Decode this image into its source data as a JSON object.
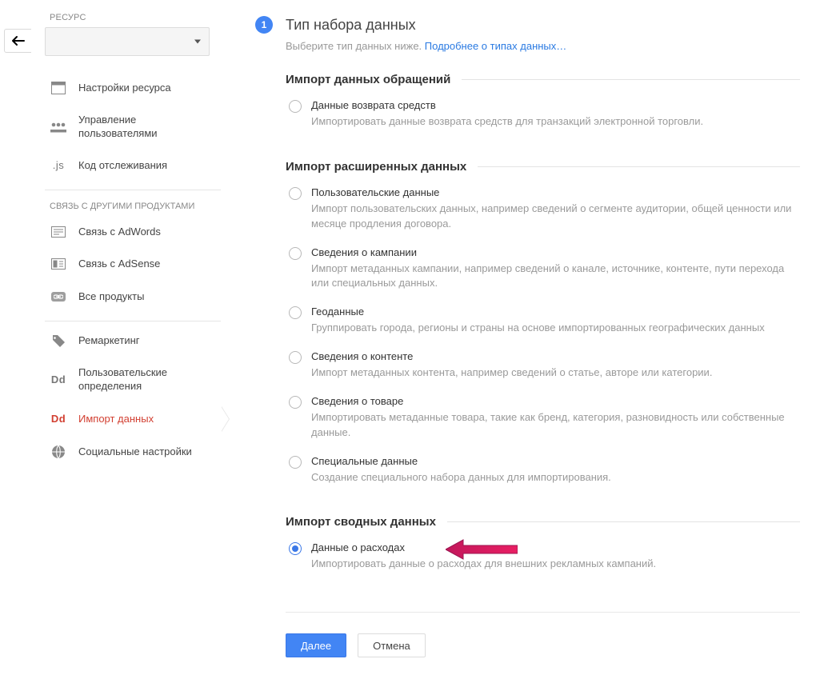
{
  "left": {
    "panel_title": "РЕСУРС",
    "dropdown_value": "",
    "nav": {
      "resource_settings": "Настройки ресурса",
      "user_management": "Управление пользователями",
      "tracking_code": "Код отслеживания"
    },
    "products_section": "СВЯЗЬ С ДРУГИМИ ПРОДУКТАМИ",
    "products": {
      "adwords": "Связь с AdWords",
      "adsense": "Связь с AdSense",
      "all": "Все продукты"
    },
    "extra": {
      "remarketing": "Ремаркетинг",
      "custom_defs": "Пользовательские определения",
      "data_import": "Импорт данных",
      "social": "Социальные настройки"
    },
    "icons": {
      "dd": "Dd",
      "js": ".js"
    }
  },
  "main": {
    "step_number": "1",
    "step_title": "Тип набора данных",
    "subtitle_prefix": "Выберите тип данных ниже. ",
    "subtitle_link": "Подробнее о типах данных…",
    "groups": {
      "hits": {
        "title": "Импорт данных обращений",
        "options": {
          "refund": {
            "title": "Данные возврата средств",
            "desc": "Импортировать данные возврата средств для транзакций электронной торговли."
          }
        }
      },
      "extended": {
        "title": "Импорт расширенных данных",
        "options": {
          "user": {
            "title": "Пользовательские данные",
            "desc": "Импорт пользовательских данных, например сведений о сегменте аудитории, общей ценности или месяце продления договора."
          },
          "campaign": {
            "title": "Сведения о кампании",
            "desc": "Импорт метаданных кампании, например сведений о канале, источнике, контенте, пути перехода или специальных данных."
          },
          "geo": {
            "title": "Геоданные",
            "desc": "Группировать города, регионы и страны на основе импортированных географических данных"
          },
          "content": {
            "title": "Сведения о контенте",
            "desc": "Импорт метаданных контента, например сведений о статье, авторе или категории."
          },
          "product": {
            "title": "Сведения о товаре",
            "desc": "Импортировать метаданные товара, такие как бренд, категория, разновидность или собственные данные."
          },
          "custom": {
            "title": "Специальные данные",
            "desc": "Создание специального набора данных для импортирования."
          }
        }
      },
      "summary": {
        "title": "Импорт сводных данных",
        "options": {
          "cost": {
            "title": "Данные о расходах",
            "desc": "Импортировать данные о расходах для внешних рекламных кампаний."
          }
        }
      }
    },
    "buttons": {
      "next": "Далее",
      "cancel": "Отмена"
    }
  }
}
